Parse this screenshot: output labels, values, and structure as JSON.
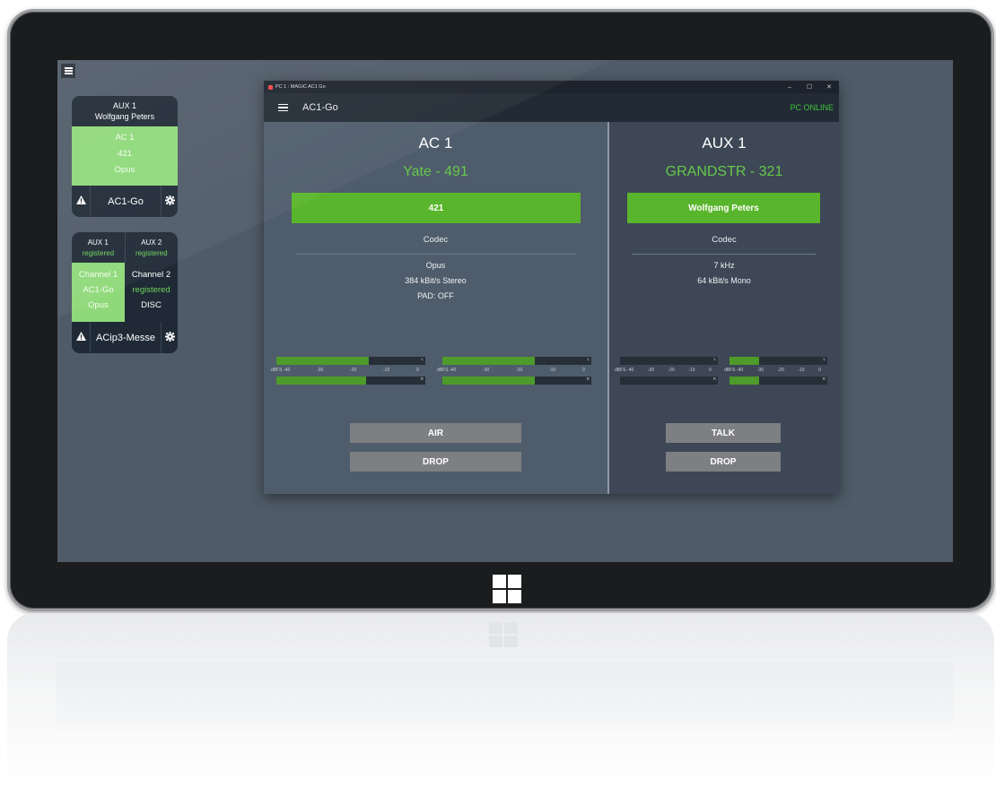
{
  "desktop": {
    "card1": {
      "header_line1": "AUX 1",
      "header_line2": "Wolfgang Peters",
      "channel": "AC 1",
      "number": "421",
      "codec": "Opus",
      "device_name": "AC1-Go"
    },
    "card2": {
      "aux1_label": "AUX 1",
      "aux1_status": "registered",
      "aux2_label": "AUX 2",
      "aux2_status": "registered",
      "ch1_label": "Channel 1",
      "ch1_line2": "AC1-Go",
      "ch1_line3": "Opus",
      "ch2_label": "Channel 2",
      "ch2_line2": "registered",
      "ch2_line3": "DISC",
      "device_name": "ACip3-Messe"
    }
  },
  "window": {
    "title": "PC 1 : MAGIC AC1 Go",
    "minimize_glyph": "–",
    "maximize_glyph": "☐",
    "close_glyph": "✕",
    "app_name": "AC1-Go",
    "status": "PC ONLINE",
    "status_color": "#3fc23a"
  },
  "left_pane": {
    "title": "AC 1",
    "subtitle": "Yate - 491",
    "bar_label": "421",
    "codec_label": "Codec",
    "codec_name": "Opus",
    "codec_rate": "384 kBit/s Stereo",
    "codec_pad": "PAD: OFF",
    "button1": "AIR",
    "button2": "DROP",
    "meters": [
      {
        "level_l": 0.62,
        "level_r": 0.6
      },
      {
        "level_l": 0.62,
        "level_r": 0.62
      }
    ]
  },
  "right_pane": {
    "title": "AUX 1",
    "subtitle": "GRANDSTR - 321",
    "bar_label": "Wolfgang Peters",
    "codec_label": "Codec",
    "codec_name": "7 kHz",
    "codec_rate": "64 kBit/s Mono",
    "button1": "TALK",
    "button2": "DROP",
    "meters": [
      {
        "level_l": 0.0,
        "level_r": 0.0
      },
      {
        "level_l": 0.3,
        "level_r": 0.3
      }
    ]
  },
  "meter_scale": {
    "unit": "dBFS",
    "ticks": [
      "-40",
      "-30",
      "-20",
      "-10",
      "0"
    ],
    "left_channel": "L",
    "right_channel": "R"
  },
  "colors": {
    "accent_green": "#59b52b",
    "card_green": "#8fd97a",
    "status_green": "#3fc23a"
  },
  "icons": {
    "warning": "warning-icon",
    "settings": "gear-icon",
    "menu": "hamburger-icon",
    "os_logo": "windows-logo-icon"
  }
}
